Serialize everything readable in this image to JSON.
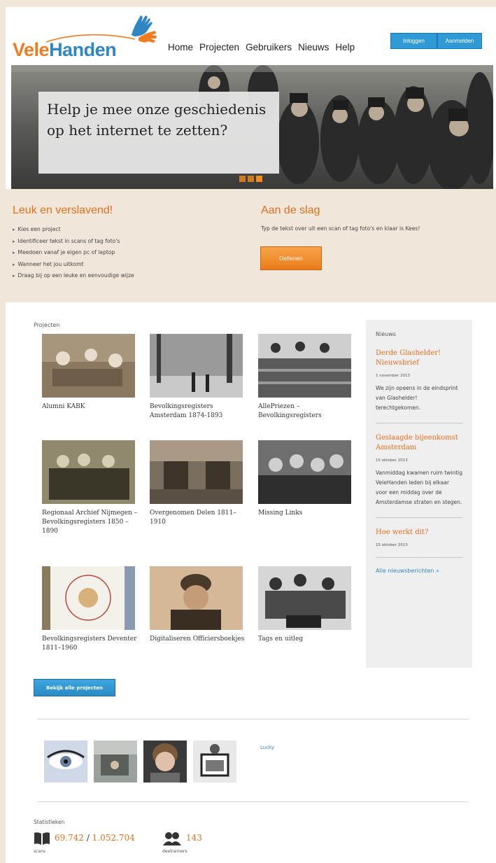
{
  "header": {
    "logo": "VeleHanden",
    "logo_part1": "Vele",
    "logo_part2": "Handen",
    "nav": [
      "Home",
      "Projecten",
      "Gebruikers",
      "Nieuws",
      "Help"
    ],
    "login_label": "Inloggen",
    "register_label": "Aanmelden"
  },
  "hero": {
    "headline": "Help je mee onze geschiedenis op het internet te zetten?",
    "slides": 3,
    "active_slide": 3
  },
  "intro": {
    "left_title": "Leuk en verslavend!",
    "bullets": [
      "Kies een project",
      "Identificeer tekst in scans of tag foto's",
      "Meedoen vanaf je eigen pc of laptop",
      "Wanneer het jou uitkomt",
      "Draag bij op een leuke en eenvoudige wijze"
    ],
    "right_title": "Aan de slag",
    "right_text": "Typ de tekst over uit een scan of tag foto's en klaar is Kees!",
    "button_label": "Oefenen"
  },
  "projects": {
    "title": "Projecten",
    "items": [
      {
        "name": "Alumni KABK"
      },
      {
        "name": "Bevolkingsregisters Amsterdam 1874-1893"
      },
      {
        "name": "AllePriezen – Bevolkingsregisters"
      },
      {
        "name": "Regionaal Archief Nijmegen – Bevolkingsregisters 1850 –1890"
      },
      {
        "name": "Overgenomen Delen 1811–1910"
      },
      {
        "name": "Missing Links"
      },
      {
        "name": "Bevolkingsregisters Deventer 1811–1960"
      },
      {
        "name": "Digitaliseren Officiersboekjes"
      },
      {
        "name": "Tags en uitleg"
      }
    ],
    "all_button": "Bekijk alle projecten"
  },
  "news": {
    "title": "Nieuws",
    "items": [
      {
        "title": "Derde Glashelder! Nieuwsbrief",
        "date": "1 november 2013",
        "text": "We zijn opeens in de eindsprint van Glashelder! terechtgekomen."
      },
      {
        "title": "Geslaagde bijeenkomst Amsterdam",
        "date": "15 oktober 2013",
        "text": "Vanmiddag kwamen ruim twintig VeleHanden leden bij elkaar voor een middag over de Amsterdamse straten en stegen."
      },
      {
        "title": "Hoe werkt dit?",
        "date": "15 oktober 2013",
        "text": ""
      }
    ],
    "more_link": "Alle nieuwsberichten »"
  },
  "users": {
    "featured_name": "Lucky"
  },
  "stats": {
    "title": "Statistieken",
    "scans_done": "69.742",
    "scans_total": "1.052.704",
    "scans_label": "scans",
    "participants": "143",
    "participants_label": "deelnemers"
  },
  "colors": {
    "orange": "#e56f1c",
    "blue": "#2f86c4",
    "beige": "#f0e6da"
  }
}
